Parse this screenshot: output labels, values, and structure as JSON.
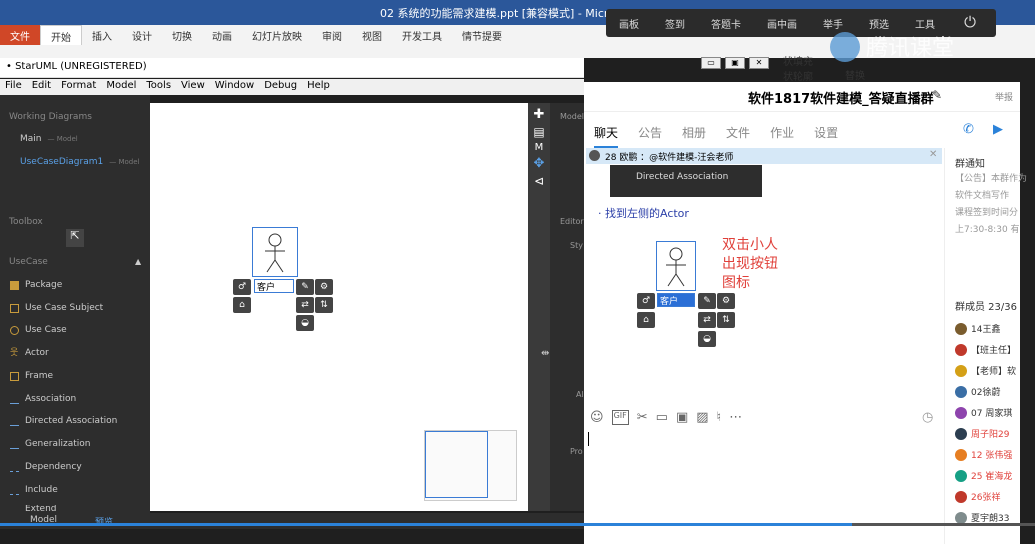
{
  "ppt": {
    "title": "02 系统的功能需求建模.ppt [兼容模式] - Microsoft Po",
    "tabs": [
      "文件",
      "开始",
      "插入",
      "设计",
      "切换",
      "动画",
      "幻灯片放映",
      "审阅",
      "视图",
      "开发工具",
      "情节提要"
    ],
    "ribbon_right": [
      "状填充",
      "状轮廓",
      "替换"
    ]
  },
  "tencent": {
    "toolbar": [
      "画板",
      "签到",
      "答题卡",
      "画中画",
      "举手",
      "预选",
      "工具"
    ],
    "logo": "腾讯课堂"
  },
  "staruml": {
    "title": "• StarUML (UNREGISTERED)",
    "menu": [
      "File",
      "Edit",
      "Format",
      "Model",
      "Tools",
      "View",
      "Window",
      "Debug",
      "Help"
    ],
    "working_diagrams": "Working Diagrams",
    "main_label": "Main",
    "main_suffix": "— Model",
    "diagram_label": "UseCaseDiagram1",
    "diagram_suffix": "— Model",
    "toolbox": "Toolbox",
    "usecase_section": "UseCase",
    "tools": [
      "Package",
      "Use Case Subject",
      "Use Case",
      "Actor",
      "Frame",
      "Association",
      "Directed Association",
      "Generalization",
      "Dependency",
      "Include",
      "Extend"
    ],
    "actor_name": "客户",
    "right_panel": [
      "Model",
      "Editor",
      "Sty",
      "Al",
      "Pro"
    ],
    "bottom_tab": "Model",
    "bottom_tab2": "预览"
  },
  "chat": {
    "title": "软件1817软件建模_答疑直播群",
    "report": "举报",
    "tabs": [
      "聊天",
      "公告",
      "相册",
      "文件",
      "作业",
      "设置"
    ],
    "pinned": "28  欧鹏 ：@软件建模-汪会老师",
    "clip_text": "Directed Association",
    "message": "· 找到左侧的Actor",
    "annotation": [
      "双击小人",
      "出现按钮",
      "图标"
    ],
    "actor_name": "客户",
    "notice_title": "群通知",
    "notice_lines": [
      "【公告】本群作为",
      "软件文档写作",
      "课程签到时间分",
      "上7:30-8:30 有"
    ],
    "members_title": "群成员 23/36",
    "members": [
      {
        "name": "14王鑫",
        "color": "#333"
      },
      {
        "name": "【班主任】",
        "color": "#333"
      },
      {
        "name": "【老师】软",
        "color": "#333"
      },
      {
        "name": "02徐蔚",
        "color": "#333"
      },
      {
        "name": "07 周家琪",
        "color": "#333"
      },
      {
        "name": "周子阳29",
        "color": "#e0403a"
      },
      {
        "name": "12 张伟强",
        "color": "#e0403a"
      },
      {
        "name": "25 崔海龙",
        "color": "#e0403a"
      },
      {
        "name": "26张祥",
        "color": "#e0403a"
      },
      {
        "name": "夏宇朗33",
        "color": "#333"
      }
    ]
  }
}
